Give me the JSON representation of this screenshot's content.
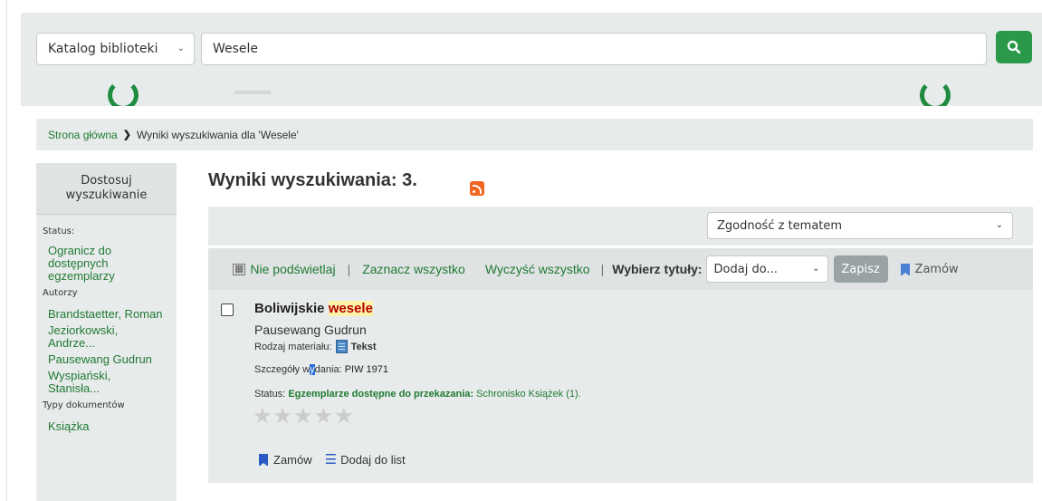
{
  "search": {
    "catalog_label": "Katalog biblioteki",
    "query": "Wesele"
  },
  "breadcrumb": {
    "home": "Strona główna",
    "current": "Wyniki wyszukiwania dla 'Wesele'"
  },
  "sidebar": {
    "header": "Dostosuj wyszukiwanie",
    "status_title": "Status:",
    "status_link": "Ogranicz do dostępnych egzemplarzy",
    "authors_title": "Autorzy",
    "authors": [
      "Brandstaetter, Roman",
      "Jeziorkowski, Andrze...",
      "Pausewang Gudrun",
      "Wyspiański, Stanisła..."
    ],
    "doctypes_title": "Typy dokumentów",
    "doctypes": [
      "Książka"
    ]
  },
  "results": {
    "title": "Wyniki wyszukiwania: 3.",
    "sort_label": "Zgodność z tematem"
  },
  "toolbar": {
    "no_highlight": "Nie podświetlaj",
    "select_all": "Zaznacz wszystko",
    "clear_all": "Wyczyść wszystko",
    "choose_titles": "Wybierz tytuły:",
    "add_to": "Dodaj do...",
    "save": "Zapisz",
    "order": "Zamów"
  },
  "record": {
    "title_prefix": "Boliwijskie ",
    "title_highlight": "wesele",
    "author": "Pausewang Gudrun",
    "material_label": "Rodzaj materiału:",
    "material_value": "Tekst",
    "pub_label_a": "Szczegóły w",
    "pub_label_b": "y",
    "pub_label_c": "dania:",
    "pub_value": "PIW 1971",
    "status_label": "Status:",
    "status_available": "Egzemplarze dostępne do przekazania:",
    "status_location": "Schronisko Książek (1).",
    "rating_stars": 0,
    "action_order": "Zamów",
    "action_list": "Dodaj do list"
  },
  "colors": {
    "accent_green": "#1f7a33",
    "search_button": "#2a9a4a",
    "rss": "#f26522",
    "highlight": "#b30000"
  }
}
